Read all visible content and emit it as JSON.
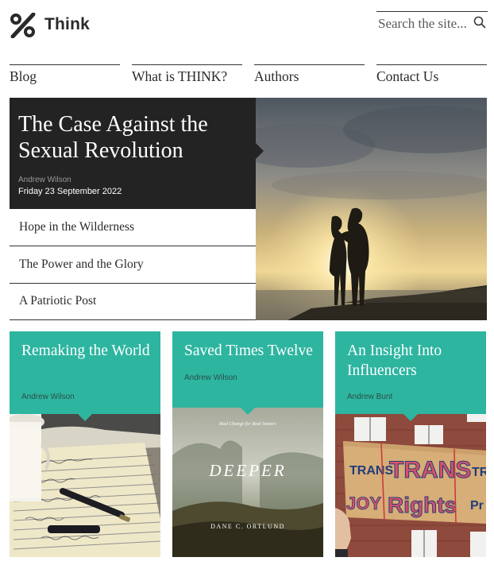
{
  "header": {
    "logo_text": "Think",
    "search_placeholder": "Search the site..."
  },
  "nav": {
    "items": [
      {
        "label": "Blog"
      },
      {
        "label": "What is THINK?"
      },
      {
        "label": "Authors"
      },
      {
        "label": "Contact Us"
      }
    ]
  },
  "featured": {
    "title": "The Case Against the Sexual Revolution",
    "author": "Andrew Wilson",
    "date": "Friday 23 September 2022",
    "image_icon": "couple-silhouette-sunset"
  },
  "more_posts": [
    {
      "title": "Hope in the Wilderness"
    },
    {
      "title": "The Power and the Glory"
    },
    {
      "title": "A Patriotic Post"
    }
  ],
  "cards": [
    {
      "title": "Remaking the World",
      "author": "Andrew Wilson",
      "image_icon": "handwritten-letter-pen"
    },
    {
      "title": "Saved Times Twelve",
      "author": "Andrew Wilson",
      "image_icon": "book-cover-deeper",
      "book": {
        "subtitle": "Real Change for Real Sinners",
        "title": "DEEPER",
        "author": "DANE C. ORTLUND"
      }
    },
    {
      "title": "An Insight Into Influencers",
      "author": "Andrew Bunt",
      "image_icon": "protest-placard",
      "placard": {
        "line1": "TRANS",
        "line2": "TRANS",
        "line3": "TR",
        "line4": "JOY",
        "line5": "Rights",
        "line6": "Pr"
      }
    }
  ],
  "colors": {
    "accent": "#2db5a0",
    "dark_panel": "#232323",
    "text": "#2a2a2a"
  }
}
